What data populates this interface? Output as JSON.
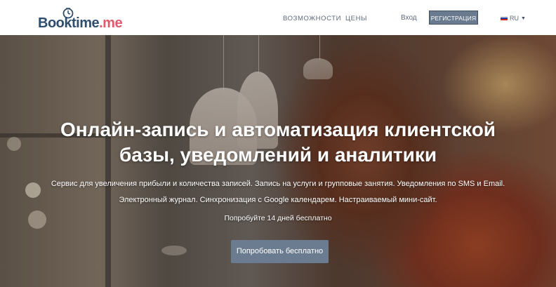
{
  "header": {
    "logo_part1": "Booktime",
    "logo_part2": ".me",
    "nav": [
      {
        "label": "ВОЗМОЖНОСТИ"
      },
      {
        "label": "ЦЕНЫ"
      }
    ],
    "login_label": "Вход",
    "register_label": "РЕГИСТРАЦИЯ",
    "language": "RU"
  },
  "hero": {
    "title_line1": "Онлайн-запись и автоматизация клиентской",
    "title_line2": "базы, уведомлений и аналитики",
    "desc_line1": "Сервис для увеличения прибыли и количества записей. Запись на услуги и групповые занятия. Уведомления по SMS и Email.",
    "desc_line2": "Электронный журнал. Синхронизация с Google календарем. Настраиваемый мини-сайт.",
    "trial_text": "Попробуйте 14 дней бесплатно",
    "cta_label": "Попробовать бесплатно"
  },
  "colors": {
    "logo_primary": "#2f4e6e",
    "logo_accent": "#e15a6b",
    "button_bg": "#6a7b8f"
  },
  "icons": {
    "logo": "clock-icon",
    "language_flag": "russia-flag-icon",
    "language_caret": "caret-down-icon"
  }
}
